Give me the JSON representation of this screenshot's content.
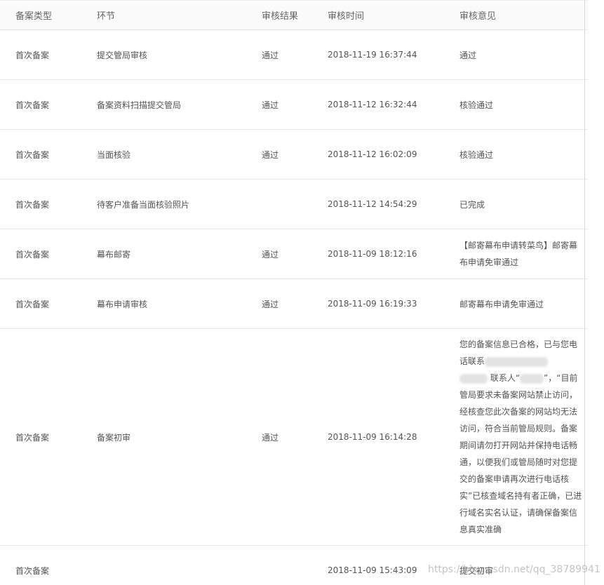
{
  "table": {
    "headers": [
      "备案类型",
      "环节",
      "审核结果",
      "审核时间",
      "审核意见"
    ],
    "rows": [
      {
        "type": "首次备案",
        "step": "提交管局审核",
        "result": "通过",
        "time": "2018-11-19 16:37:44",
        "opinion": "通过"
      },
      {
        "type": "首次备案",
        "step": "备案资料扫描提交管局",
        "result": "通过",
        "time": "2018-11-12 16:32:44",
        "opinion": "核验通过"
      },
      {
        "type": "首次备案",
        "step": "当面核验",
        "result": "通过",
        "time": "2018-11-12 16:02:09",
        "opinion": "核验通过"
      },
      {
        "type": "首次备案",
        "step": "待客户准备当面核验照片",
        "result": "",
        "time": "2018-11-12 14:54:29",
        "opinion": "已完成"
      },
      {
        "type": "首次备案",
        "step": "幕布邮寄",
        "result": "通过",
        "time": "2018-11-09 18:12:16",
        "opinion": "【邮寄幕布申请转菜鸟】邮寄幕布申请免审通过"
      },
      {
        "type": "首次备案",
        "step": "幕布申请审核",
        "result": "通过",
        "time": "2018-11-09 16:19:33",
        "opinion": "邮寄幕布申请免审通过"
      },
      {
        "type": "首次备案",
        "step": "备案初审",
        "result": "通过",
        "time": "2018-11-09 16:14:28",
        "opinion_parts": {
          "line1": "您的备案信息已合格，已与您",
          "line2_start": "电话联系",
          "line3_mid": "联系人“",
          "line3_end": "”，“目",
          "rest": "前管局要求未备案网站禁止访问，经核查您此次备案的网站均无法访问，符合当前管局规则。备案期间请勿打开网站并保持电话畅通，以便我们或管局随时对您提交的备案申请再次进行电话核实”已核查域名持有者正确，已进行域名实名认证，请确保备案信息真实准确"
        }
      },
      {
        "type": "首次备案",
        "step": "",
        "result": "",
        "time": "2018-11-09 15:43:09",
        "opinion": "提交初审"
      }
    ]
  },
  "watermark": "https://blog.csdn.net/qq_38789941"
}
